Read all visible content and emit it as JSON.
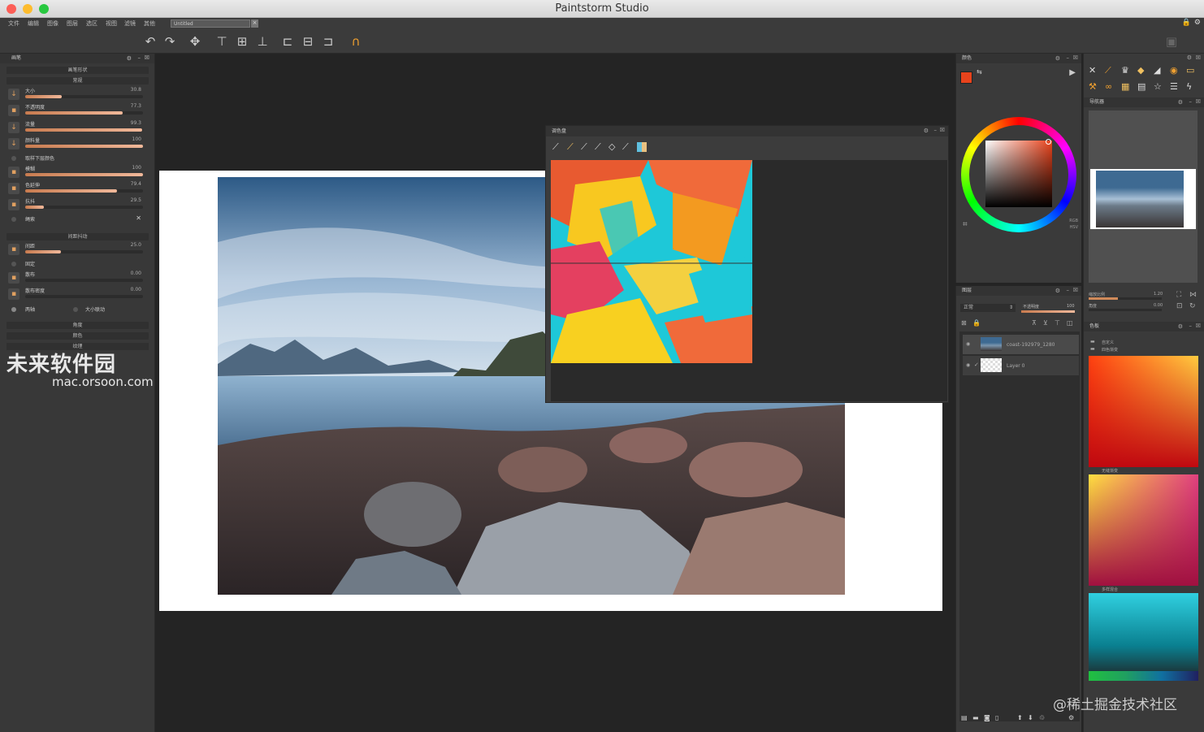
{
  "window": {
    "title": "Paintstorm Studio"
  },
  "menu": [
    "文件",
    "编辑",
    "图像",
    "图层",
    "选区",
    "视图",
    "滤镜",
    "其他"
  ],
  "document_tab": {
    "name": "Untitled",
    "close": "×"
  },
  "brush_panel": {
    "title": "画笔",
    "sections": {
      "shape": "画笔形状",
      "general": "常规",
      "spacing": "间距抖动",
      "angle": "角度",
      "color": "颜色",
      "texture": "纹理"
    },
    "params": [
      {
        "label": "大小",
        "value": "30.8",
        "fraction": 0.31
      },
      {
        "label": "不透明度",
        "value": "77.3",
        "fraction": 0.83
      },
      {
        "label": "流量",
        "value": "99.3",
        "fraction": 0.99
      },
      {
        "label": "颜料量",
        "value": "100",
        "fraction": 1.0
      },
      {
        "label": "模糊",
        "value": "100",
        "fraction": 1.0
      },
      {
        "label": "色延伸",
        "value": "79.4",
        "fraction": 0.78
      },
      {
        "label": "抗抖",
        "value": "29.5",
        "fraction": 0.16
      }
    ],
    "pick_under": "取样下层颜色",
    "rope": "绳索",
    "spacing_params": [
      {
        "label": "间距",
        "value": "25.0",
        "fraction": 0.3
      },
      {
        "label": "散布",
        "value": "0.00",
        "fraction": 0.0
      },
      {
        "label": "散布密度",
        "value": "0.00",
        "fraction": 0.0
      }
    ],
    "fixed": "固定",
    "both_axes": "两轴",
    "size_link": "大小联动"
  },
  "palette": {
    "title": "调色盘"
  },
  "color_panel": {
    "title": "颜色",
    "rgb": "RGB",
    "hsv": "HSV",
    "fg_color": "#e8431c"
  },
  "layers_panel": {
    "title": "图层",
    "blend": "正常",
    "opacity_label": "不透明度",
    "opacity_value": "100",
    "layers": [
      {
        "name": "coast-192979_1280"
      },
      {
        "name": "Layer 0"
      }
    ]
  },
  "navigator": {
    "title": "导航器",
    "zoom_label": "缩放比例",
    "zoom_value": "1.20",
    "angle_label": "角度",
    "angle_value": "0.00"
  },
  "swatches": {
    "title": "色板",
    "group1": "自定义",
    "group1b": "四色渐变",
    "group2": "无缝渐变",
    "group3": "多样混合"
  },
  "watermark": {
    "text": "未来软件园",
    "sub": "mac.orsoon.com",
    "credit": "@稀土掘金技术社区"
  }
}
